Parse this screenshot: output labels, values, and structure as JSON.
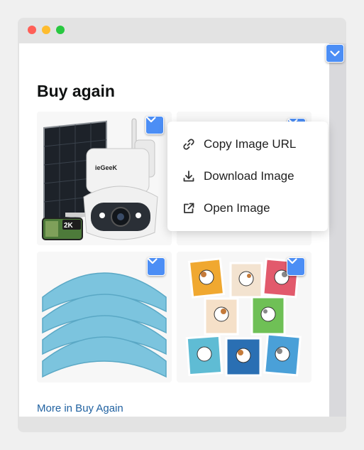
{
  "window": {
    "controls": [
      "close",
      "minimize",
      "maximize"
    ]
  },
  "section": {
    "title": "Buy again",
    "more_link": "More in Buy Again"
  },
  "products": [
    {
      "icon": "security-camera-image",
      "badge": "2K",
      "brand": "ieGeek"
    },
    {
      "icon": "product-image-obscured"
    },
    {
      "icon": "mop-pads-image"
    },
    {
      "icon": "cat-stickers-image"
    }
  ],
  "context_menu": {
    "items": [
      {
        "label": "Copy Image URL",
        "icon": "link-icon"
      },
      {
        "label": "Download Image",
        "icon": "download-icon"
      },
      {
        "label": "Open Image",
        "icon": "external-link-icon"
      }
    ]
  },
  "colors": {
    "accent": "#4c8ef5",
    "link": "#2162a1",
    "title": "#0f1111"
  }
}
